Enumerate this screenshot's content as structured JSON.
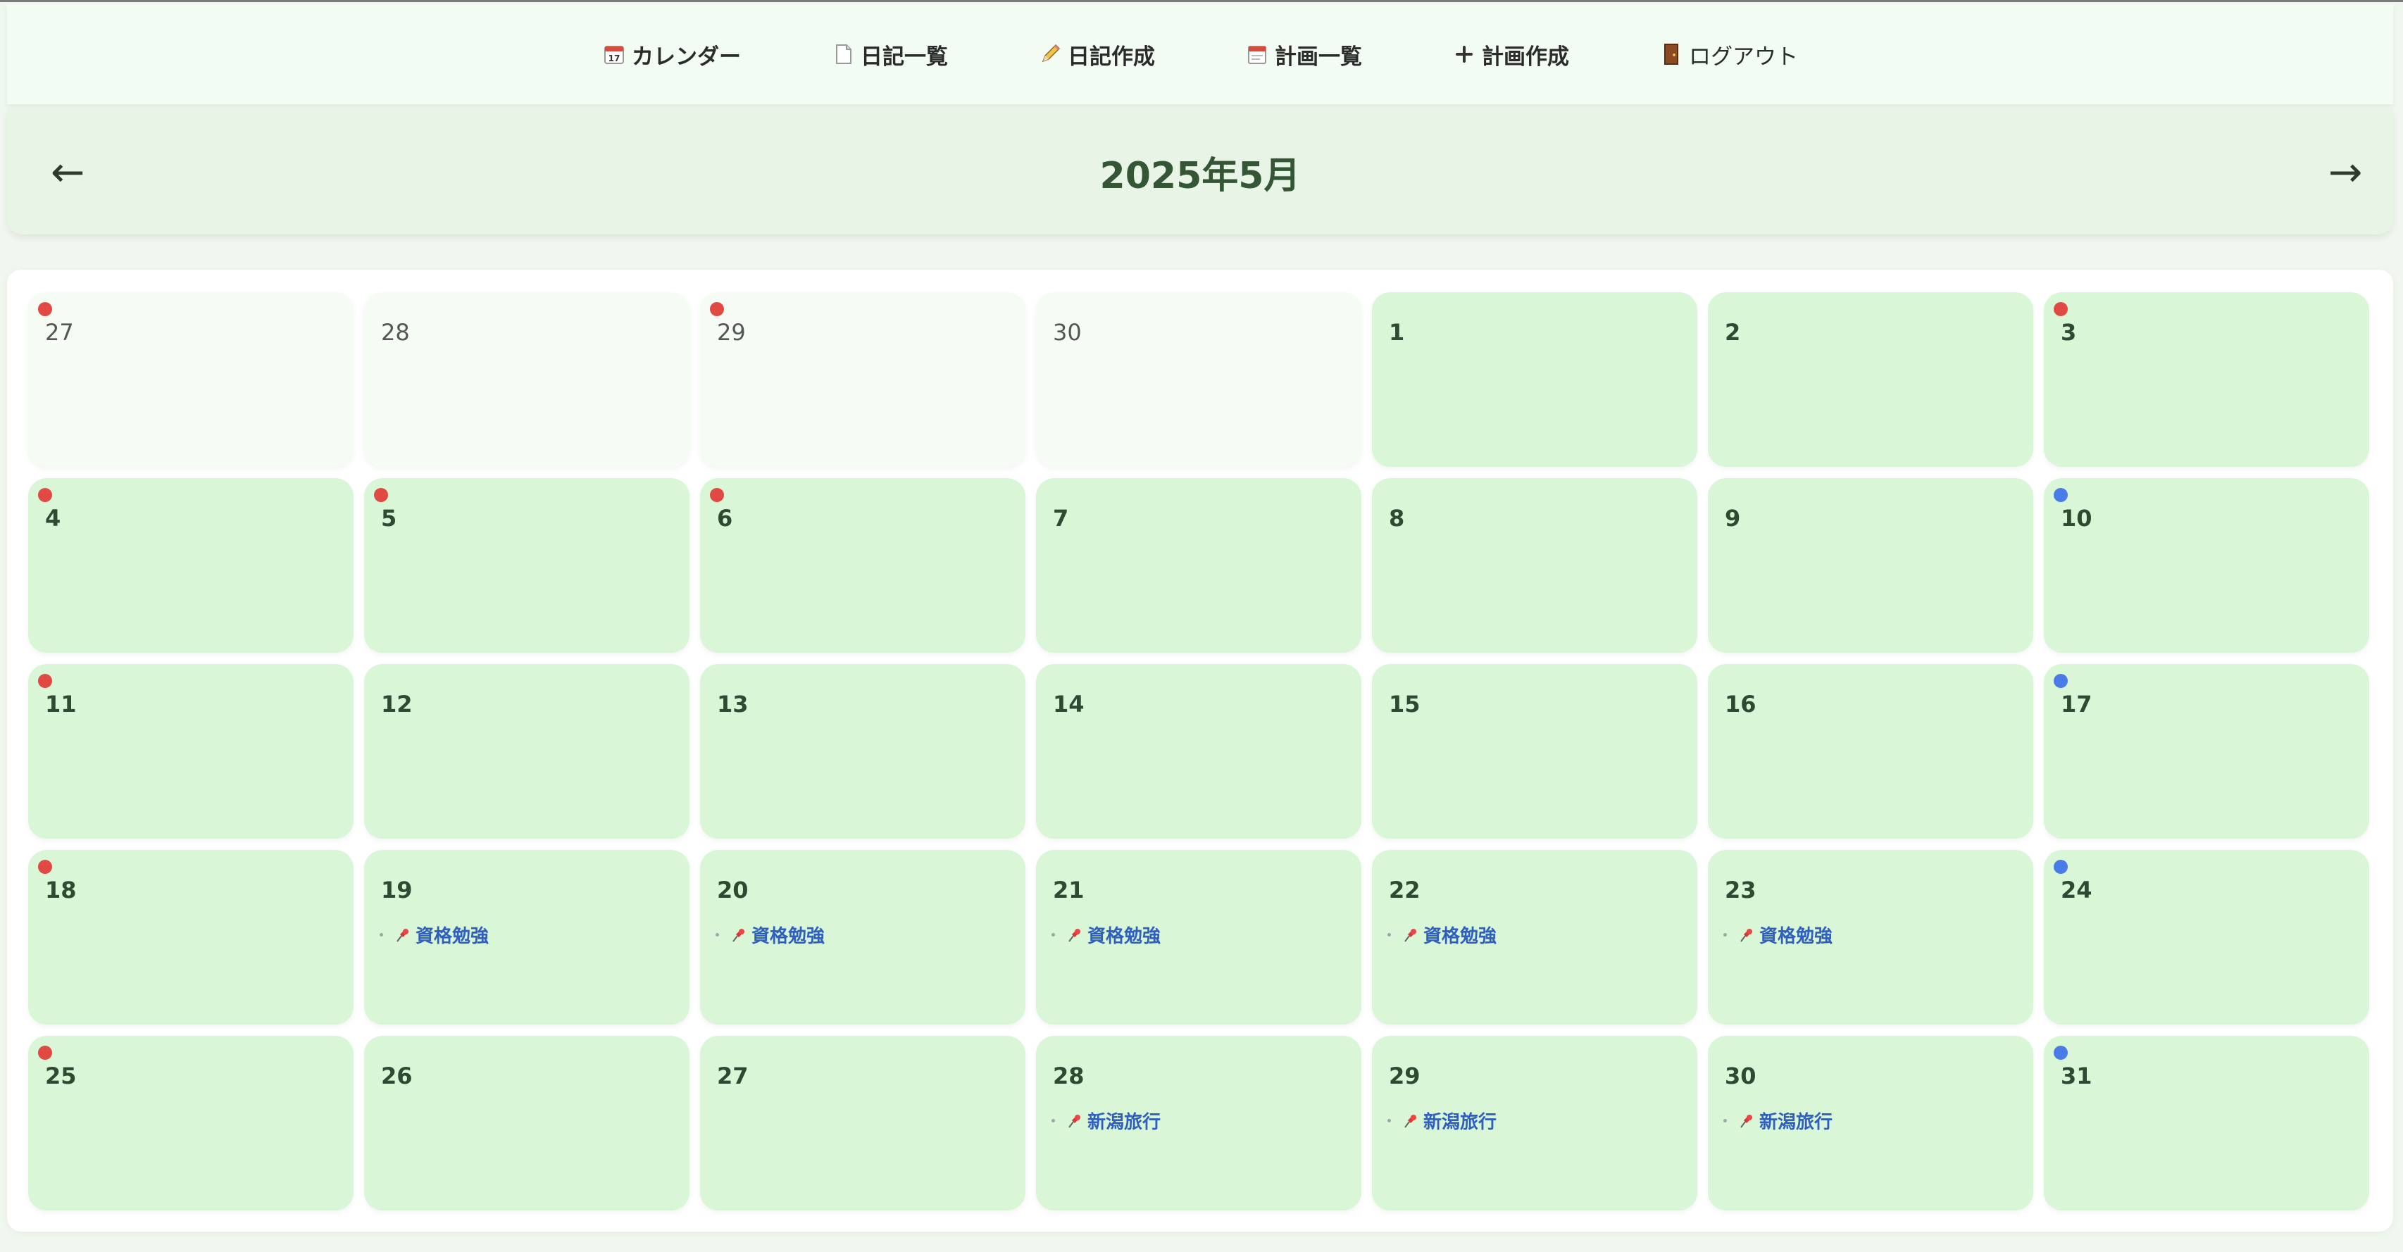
{
  "nav": [
    {
      "label": "カレンダー",
      "icon": "calendar-icon"
    },
    {
      "label": "日記一覧",
      "icon": "document-icon"
    },
    {
      "label": "日記作成",
      "icon": "pencil-icon"
    },
    {
      "label": "計画一覧",
      "icon": "planner-icon"
    },
    {
      "label": "計画作成",
      "icon": "plus-icon"
    },
    {
      "label": "ログアウト",
      "icon": "door-icon"
    }
  ],
  "month_title": "2025年5月",
  "prev_arrow": "←",
  "next_arrow": "→",
  "colors": {
    "dot_red": "#e04a43",
    "dot_blue": "#4a7be8",
    "event_text": "#2f5fbf",
    "day_bg": "#d9f6d7",
    "day_other_bg": "#f4fcf3"
  },
  "days": [
    {
      "day": "27",
      "other": true,
      "dot": "red"
    },
    {
      "day": "28",
      "other": true
    },
    {
      "day": "29",
      "other": true,
      "dot": "red"
    },
    {
      "day": "30",
      "other": true
    },
    {
      "day": "1"
    },
    {
      "day": "2"
    },
    {
      "day": "3",
      "dot": "red"
    },
    {
      "day": "4",
      "dot": "red"
    },
    {
      "day": "5",
      "dot": "red"
    },
    {
      "day": "6",
      "dot": "red"
    },
    {
      "day": "7"
    },
    {
      "day": "8"
    },
    {
      "day": "9"
    },
    {
      "day": "10",
      "dot": "blue"
    },
    {
      "day": "11",
      "dot": "red"
    },
    {
      "day": "12"
    },
    {
      "day": "13"
    },
    {
      "day": "14"
    },
    {
      "day": "15"
    },
    {
      "day": "16"
    },
    {
      "day": "17",
      "dot": "blue"
    },
    {
      "day": "18",
      "dot": "red"
    },
    {
      "day": "19",
      "event": "資格勉強"
    },
    {
      "day": "20",
      "event": "資格勉強"
    },
    {
      "day": "21",
      "event": "資格勉強"
    },
    {
      "day": "22",
      "event": "資格勉強"
    },
    {
      "day": "23",
      "event": "資格勉強"
    },
    {
      "day": "24",
      "dot": "blue"
    },
    {
      "day": "25",
      "dot": "red"
    },
    {
      "day": "26"
    },
    {
      "day": "27"
    },
    {
      "day": "28",
      "event": "新潟旅行"
    },
    {
      "day": "29",
      "event": "新潟旅行"
    },
    {
      "day": "30",
      "event": "新潟旅行"
    },
    {
      "day": "31",
      "dot": "blue"
    }
  ]
}
